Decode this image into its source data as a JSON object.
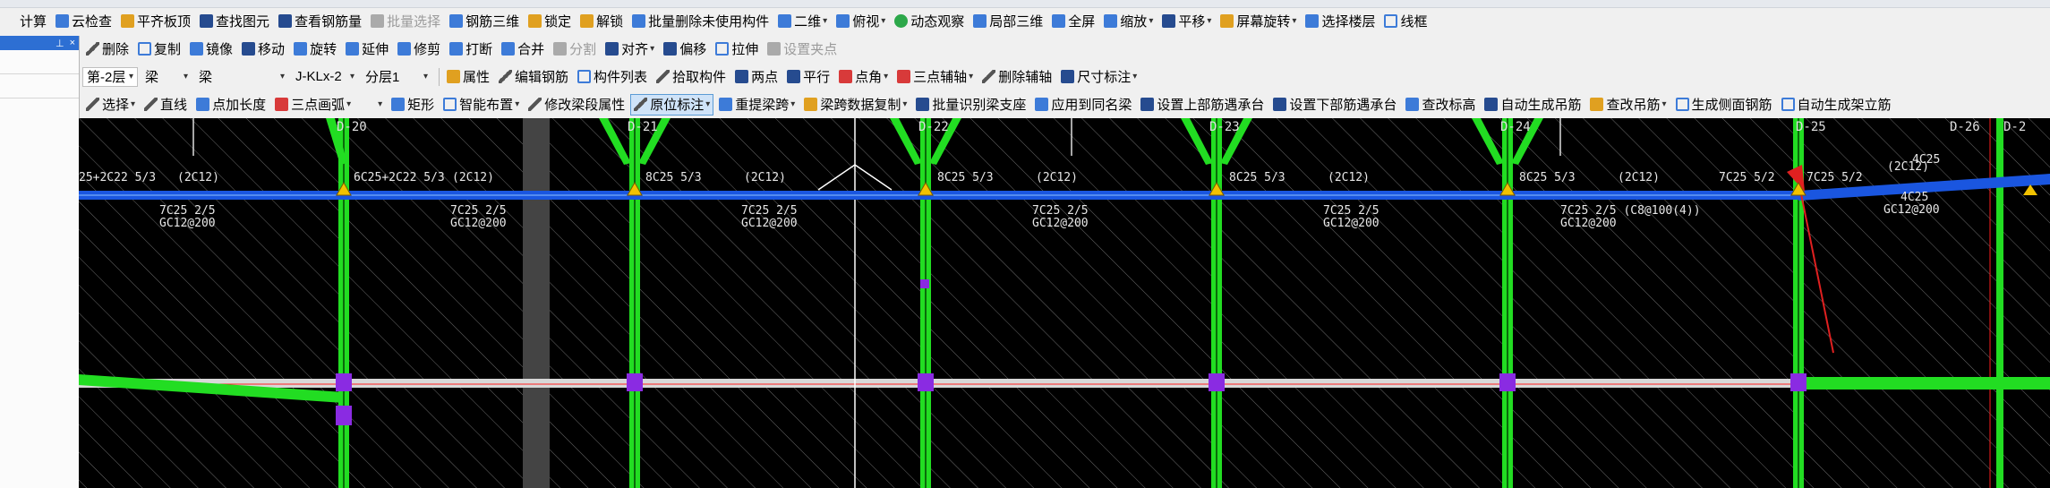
{
  "row1": [
    {
      "label": "计算",
      "icon": "calc-icon",
      "color": "none"
    },
    {
      "label": "云检查",
      "icon": "cloud-check-icon",
      "color": "blue"
    },
    {
      "label": "平齐板顶",
      "icon": "align-top-icon",
      "color": "orange"
    },
    {
      "label": "查找图元",
      "icon": "find-element-icon",
      "color": "navy"
    },
    {
      "label": "查看钢筋量",
      "icon": "rebar-quantity-icon",
      "color": "navy"
    },
    {
      "label": "批量选择",
      "icon": "batch-select-icon",
      "color": "gray",
      "disabled": true
    },
    {
      "label": "钢筋三维",
      "icon": "rebar-3d-icon",
      "color": "blue"
    },
    {
      "label": "锁定",
      "icon": "lock-icon",
      "color": "orange"
    },
    {
      "label": "解锁",
      "icon": "unlock-icon",
      "color": "orange"
    },
    {
      "label": "批量删除未使用构件",
      "icon": "batch-delete-icon",
      "color": "blue"
    },
    {
      "label": "二维",
      "icon": "2d-view-icon",
      "color": "blue",
      "dropdown": true
    },
    {
      "label": "俯视",
      "icon": "top-view-icon",
      "color": "blue",
      "dropdown": true
    },
    {
      "label": "动态观察",
      "icon": "orbit-icon",
      "color": "green"
    },
    {
      "label": "局部三维",
      "icon": "partial-3d-icon",
      "color": "blue"
    },
    {
      "label": "全屏",
      "icon": "fullscreen-icon",
      "color": "blue"
    },
    {
      "label": "缩放",
      "icon": "zoom-icon",
      "color": "blue",
      "dropdown": true
    },
    {
      "label": "平移",
      "icon": "pan-icon",
      "color": "navy",
      "dropdown": true
    },
    {
      "label": "屏幕旋转",
      "icon": "screen-rotate-icon",
      "color": "orange",
      "dropdown": true
    },
    {
      "label": "选择楼层",
      "icon": "select-floor-icon",
      "color": "blue"
    },
    {
      "label": "线框",
      "icon": "wireframe-icon",
      "color": "outline"
    }
  ],
  "row2": [
    {
      "label": "删除",
      "icon": "delete-icon",
      "color": "diag"
    },
    {
      "label": "复制",
      "icon": "copy-icon",
      "color": "outline"
    },
    {
      "label": "镜像",
      "icon": "mirror-icon",
      "color": "blue"
    },
    {
      "label": "移动",
      "icon": "move-icon",
      "color": "navy"
    },
    {
      "label": "旋转",
      "icon": "rotate-icon",
      "color": "blue"
    },
    {
      "label": "延伸",
      "icon": "extend-icon",
      "color": "blue"
    },
    {
      "label": "修剪",
      "icon": "trim-icon",
      "color": "blue"
    },
    {
      "label": "打断",
      "icon": "break-icon",
      "color": "blue"
    },
    {
      "label": "合并",
      "icon": "merge-icon",
      "color": "blue"
    },
    {
      "label": "分割",
      "icon": "split-icon",
      "color": "gray",
      "disabled": true
    },
    {
      "label": "对齐",
      "icon": "align-icon",
      "color": "navy",
      "dropdown": true
    },
    {
      "label": "偏移",
      "icon": "offset-icon",
      "color": "navy"
    },
    {
      "label": "拉伸",
      "icon": "stretch-icon",
      "color": "outline"
    },
    {
      "label": "设置夹点",
      "icon": "grip-point-icon",
      "color": "gray",
      "disabled": true
    }
  ],
  "row3": {
    "floor": "第-2层",
    "category": "梁",
    "type": "梁",
    "component": "J-KLx-2",
    "layer": "分层1",
    "tools": [
      {
        "label": "属性",
        "icon": "properties-icon",
        "color": "orange"
      },
      {
        "label": "编辑钢筋",
        "icon": "edit-rebar-icon",
        "color": "diag"
      },
      {
        "label": "构件列表",
        "icon": "component-list-icon",
        "color": "outline"
      },
      {
        "label": "拾取构件",
        "icon": "pick-component-icon",
        "color": "diag"
      },
      {
        "label": "两点",
        "icon": "two-point-icon",
        "color": "navy"
      },
      {
        "label": "平行",
        "icon": "parallel-icon",
        "color": "navy"
      },
      {
        "label": "点角",
        "icon": "point-angle-icon",
        "color": "red",
        "dropdown": true
      },
      {
        "label": "三点辅轴",
        "icon": "three-point-axis-icon",
        "color": "red",
        "dropdown": true
      },
      {
        "label": "删除辅轴",
        "icon": "delete-axis-icon",
        "color": "diag"
      },
      {
        "label": "尺寸标注",
        "icon": "dimension-icon",
        "color": "navy",
        "dropdown": true
      }
    ]
  },
  "row4": [
    {
      "label": "选择",
      "icon": "select-cursor-icon",
      "color": "diag",
      "dropdown": true
    },
    {
      "label": "直线",
      "icon": "line-icon",
      "color": "diag"
    },
    {
      "label": "点加长度",
      "icon": "point-length-icon",
      "color": "blue"
    },
    {
      "label": "三点画弧",
      "icon": "three-point-arc-icon",
      "color": "red",
      "dropdown": true
    },
    {
      "label": "",
      "icon": "",
      "color": "none",
      "dropdown": true
    },
    {
      "label": "矩形",
      "icon": "rectangle-icon",
      "color": "blue"
    },
    {
      "label": "智能布置",
      "icon": "smart-layout-icon",
      "color": "outline",
      "dropdown": true
    },
    {
      "label": "修改梁段属性",
      "icon": "modify-span-icon",
      "color": "diag"
    },
    {
      "label": "原位标注",
      "icon": "in-situ-annotation-icon",
      "color": "diag",
      "dropdown": true,
      "active": true
    },
    {
      "label": "重提梁跨",
      "icon": "reextract-span-icon",
      "color": "blue",
      "dropdown": true
    },
    {
      "label": "梁跨数据复制",
      "icon": "span-data-copy-icon",
      "color": "orange",
      "dropdown": true
    },
    {
      "label": "批量识别梁支座",
      "icon": "batch-support-icon",
      "color": "navy"
    },
    {
      "label": "应用到同名梁",
      "icon": "apply-same-name-icon",
      "color": "blue"
    },
    {
      "label": "设置上部筋遇承台",
      "icon": "top-rebar-pilecap-icon",
      "color": "navy"
    },
    {
      "label": "设置下部筋遇承台",
      "icon": "bottom-rebar-pilecap-icon",
      "color": "navy"
    },
    {
      "label": "查改标高",
      "icon": "edit-elevation-icon",
      "color": "blue"
    },
    {
      "label": "自动生成吊筋",
      "icon": "auto-hanger-icon",
      "color": "navy"
    },
    {
      "label": "查改吊筋",
      "icon": "edit-hanger-icon",
      "color": "orange",
      "dropdown": true
    },
    {
      "label": "生成侧面钢筋",
      "icon": "side-rebar-icon",
      "color": "outline"
    },
    {
      "label": "自动生成架立筋",
      "icon": "auto-erection-icon",
      "color": "outline"
    }
  ],
  "panel": {
    "pin": "⊥",
    "close": "×"
  },
  "grid_labels": [
    "D-20",
    "D-21",
    "D-22",
    "D-23",
    "D-24",
    "D-25",
    "D-26",
    "D-2"
  ],
  "top_annotations": [
    {
      "top": "25+2C22 5/3",
      "mid": "(2C12)"
    },
    {
      "top": "6C25+2C22 5/3",
      "mid": "(2C12)"
    },
    {
      "top": "8C25 5/3",
      "mid": "(2C12)"
    },
    {
      "top": "8C25 5/3",
      "mid": "(2C12)"
    },
    {
      "top": "8C25 5/3",
      "mid": "(2C12)"
    },
    {
      "top": "8C25 5/3",
      "mid": "(2C12)"
    },
    {
      "top": "7C25 5/2",
      "mid": "7C25 5/2"
    }
  ],
  "bottom_annotations": [
    {
      "line1": "7C25 2/5",
      "line2": "GC12@200"
    },
    {
      "line1": "7C25 2/5",
      "line2": "GC12@200"
    },
    {
      "line1": "7C25 2/5",
      "line2": "GC12@200"
    },
    {
      "line1": "7C25 2/5",
      "line2": "GC12@200"
    },
    {
      "line1": "7C25 2/5",
      "line2": "GC12@200"
    },
    {
      "line1": "7C25 2/5 (C8@100(4))",
      "line2": "GC12@200"
    }
  ],
  "right_annotations": {
    "a": "(2C12)",
    "b": "4C25",
    "c": "4C25",
    "d": "GC12@200"
  },
  "colors": {
    "beam": "#1a56e0",
    "column": "#22dd22",
    "support": "#8a2be2",
    "axis": "#d8d8d8"
  }
}
